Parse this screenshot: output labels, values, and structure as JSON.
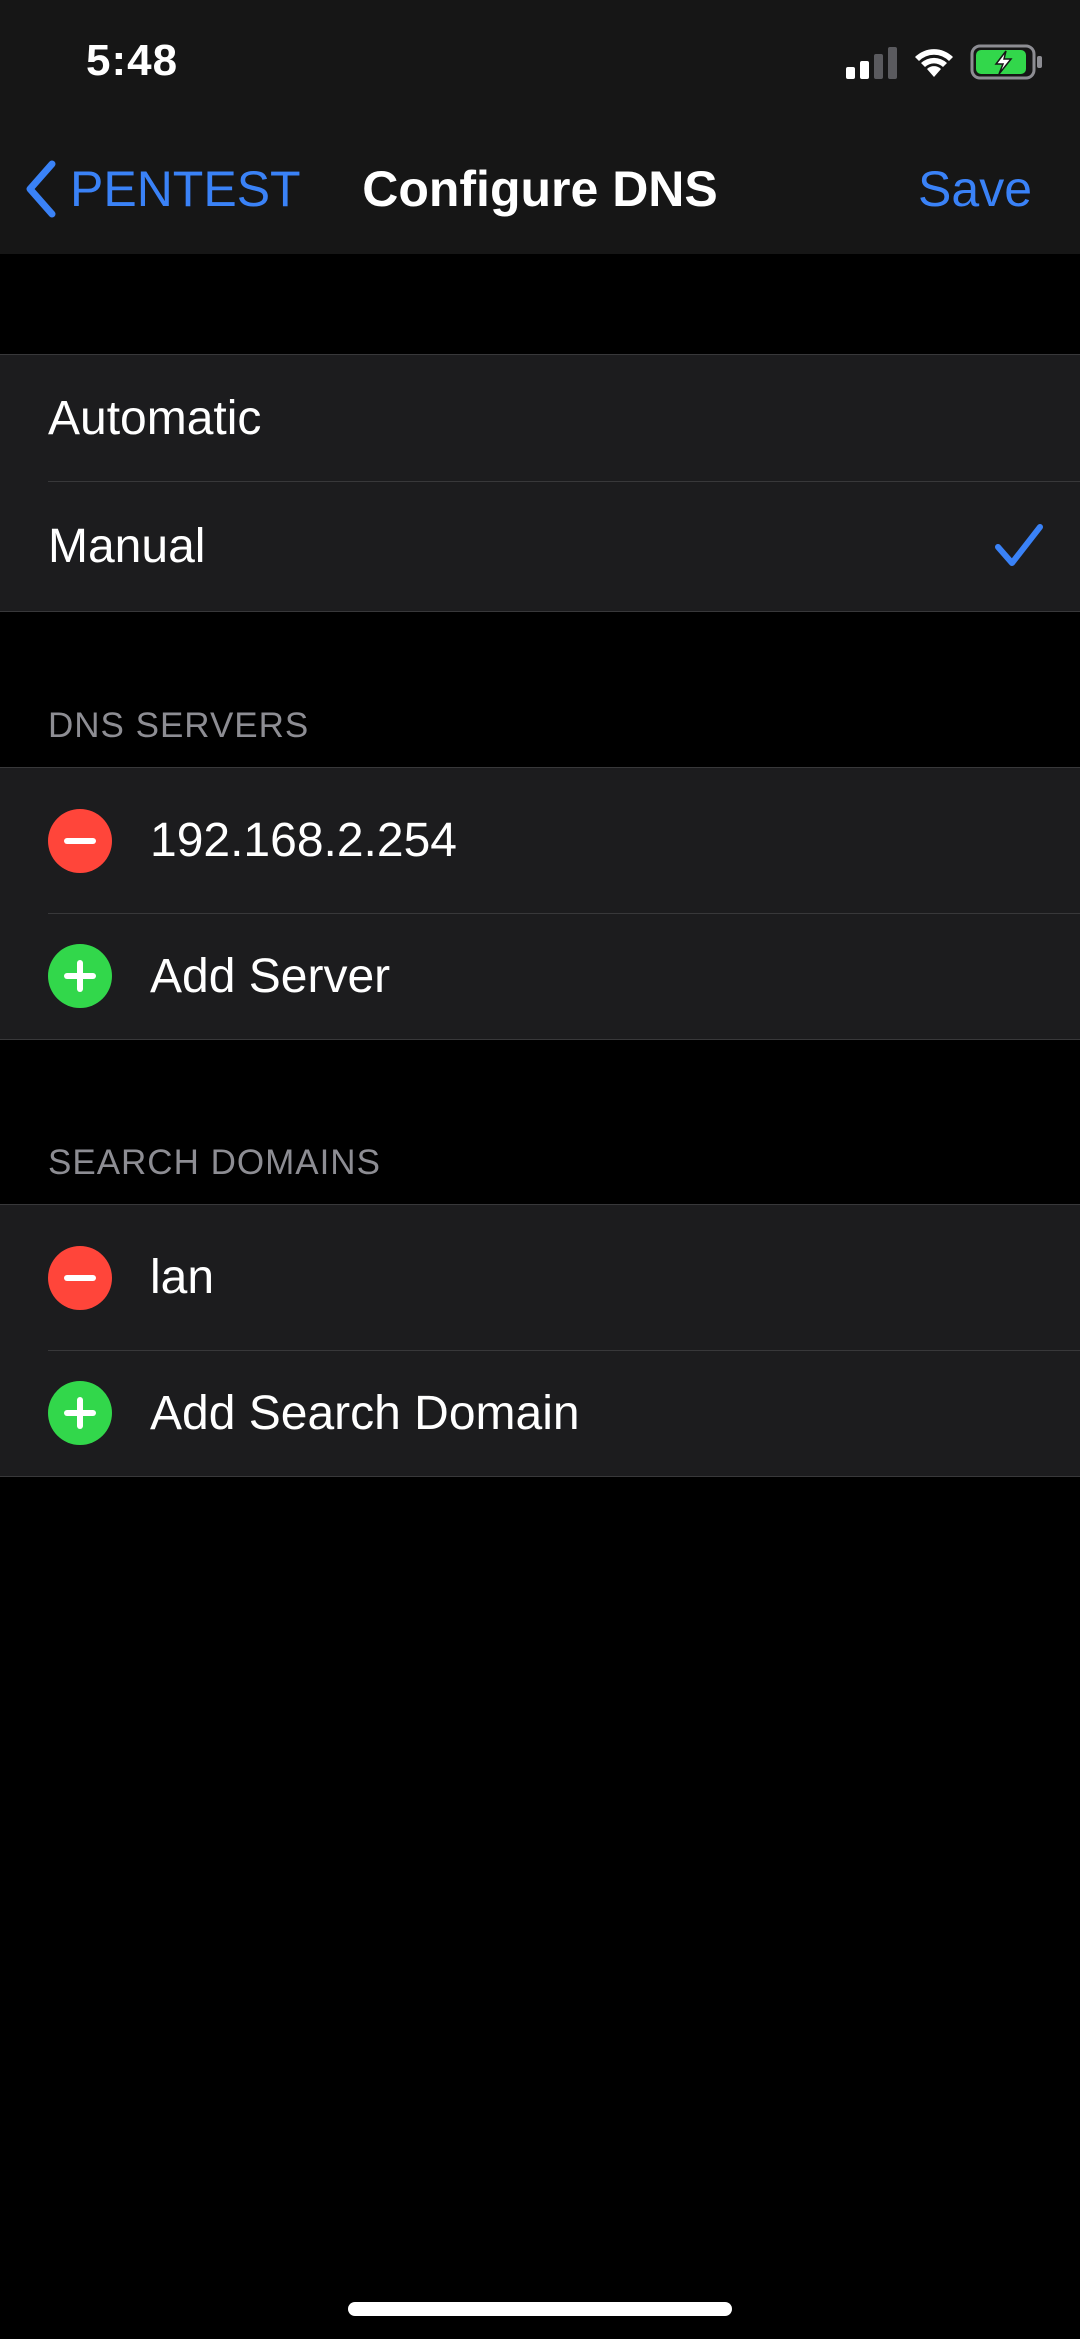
{
  "status": {
    "time": "5:48",
    "icons": [
      "cellular-signal-icon",
      "wifi-icon",
      "battery-charging-icon"
    ]
  },
  "nav": {
    "back_label": "PENTEST",
    "title": "Configure DNS",
    "save_label": "Save"
  },
  "mode": {
    "options": [
      "Automatic",
      "Manual"
    ],
    "selected": "Manual"
  },
  "dns_servers": {
    "header": "DNS SERVERS",
    "entries": [
      "192.168.2.254"
    ],
    "add_label": "Add Server"
  },
  "search_domains": {
    "header": "SEARCH DOMAINS",
    "entries": [
      "lan"
    ],
    "add_label": "Add Search Domain"
  },
  "colors": {
    "accent": "#3a82f7",
    "remove": "#ff453a",
    "add": "#32d74b",
    "background": "#000000",
    "cell": "#1c1c1e"
  }
}
